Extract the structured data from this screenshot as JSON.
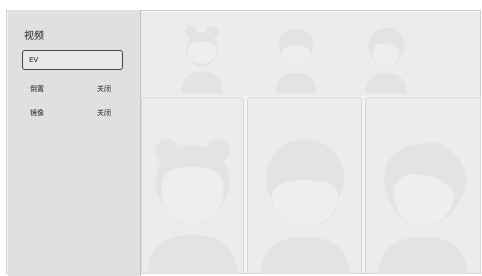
{
  "sidebar": {
    "title": "视频",
    "ev_label": "EV",
    "settings": [
      {
        "label": "倒置",
        "value": "关闭"
      },
      {
        "label": "镜像",
        "value": "关闭"
      }
    ]
  },
  "grid": {
    "avatars": [
      "bun-hair-avatar",
      "short-hair-avatar",
      "side-swept-hair-avatar"
    ]
  },
  "colors": {
    "sidebar_bg": "#dfe0df",
    "panel_bg": "#ececec",
    "avatar_fill": "#e3e3e3",
    "avatar_stroke": "#e0e0e0"
  }
}
